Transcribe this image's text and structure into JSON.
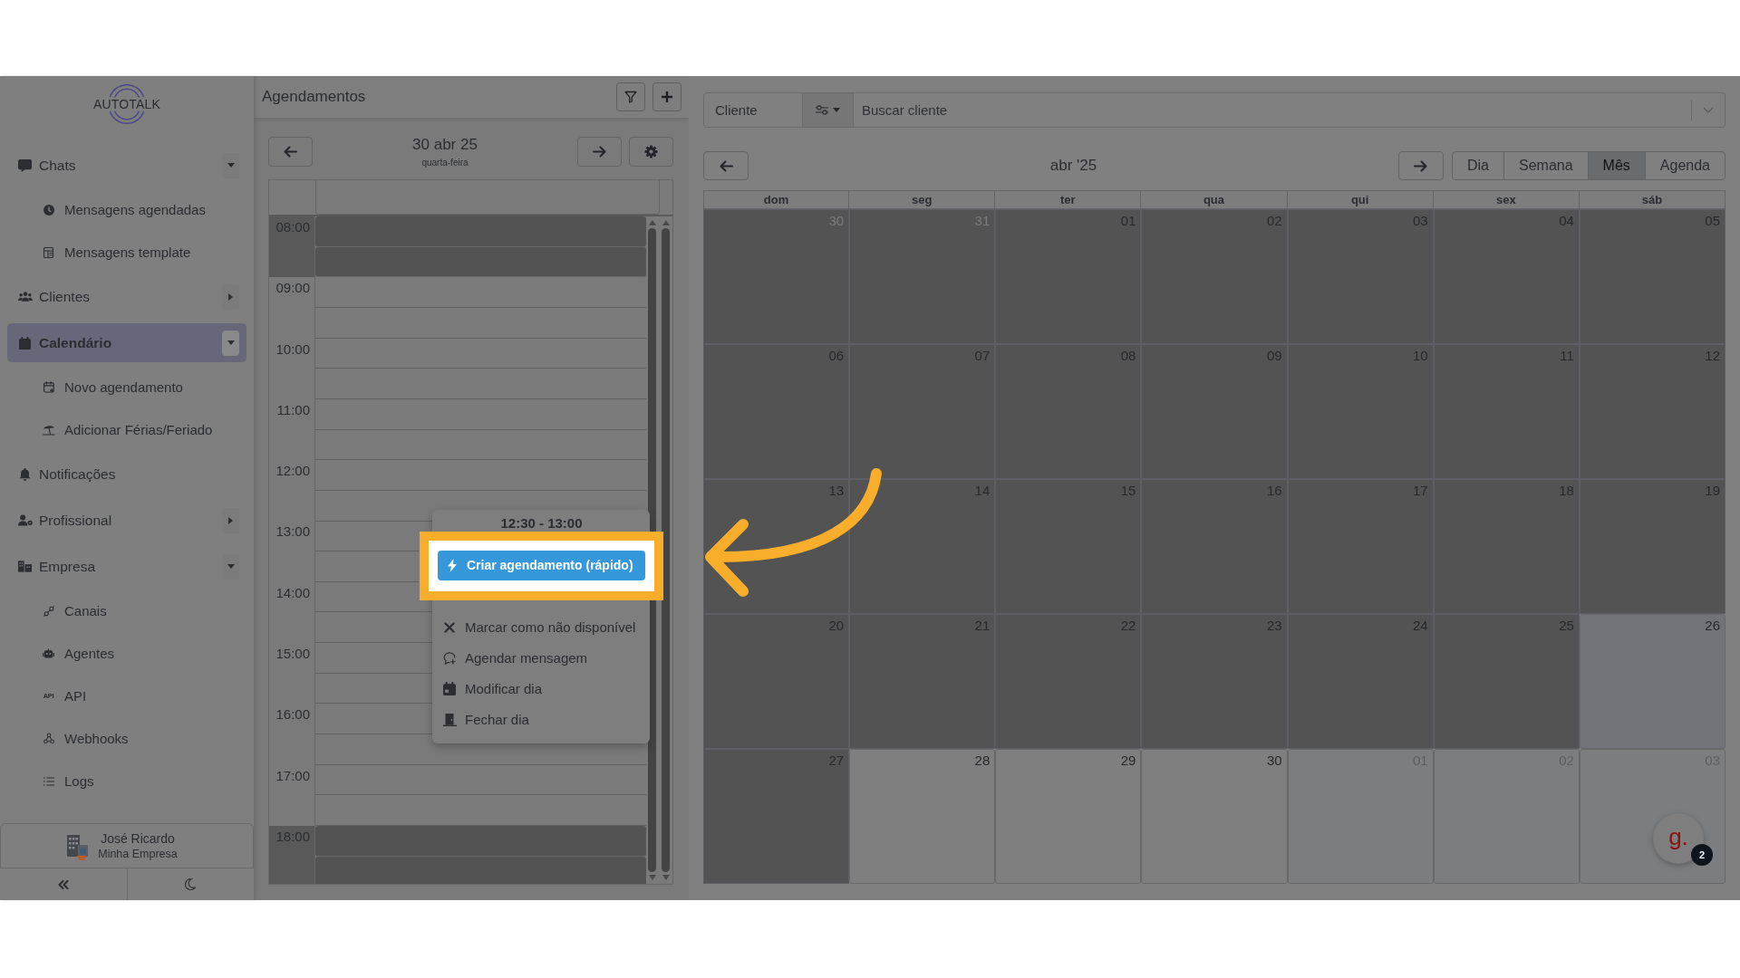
{
  "sidebar": {
    "logo": "AUTOTALK",
    "items": [
      {
        "kind": "group",
        "label": "Chats",
        "expanded": true,
        "selected": false,
        "children": [
          {
            "label": "Mensagens agendadas"
          },
          {
            "label": "Mensagens template"
          }
        ]
      },
      {
        "kind": "group",
        "label": "Clientes",
        "expanded": false,
        "selected": false
      },
      {
        "kind": "group",
        "label": "Calendário",
        "expanded": true,
        "selected": true,
        "children": [
          {
            "label": "Novo agendamento"
          },
          {
            "label": "Adicionar Férias/Feriado"
          }
        ]
      },
      {
        "kind": "link",
        "label": "Notificações",
        "selected": false
      },
      {
        "kind": "group",
        "label": "Profissional",
        "expanded": false,
        "selected": false
      },
      {
        "kind": "group",
        "label": "Empresa",
        "expanded": true,
        "selected": false,
        "children": [
          {
            "label": "Canais"
          },
          {
            "label": "Agentes"
          },
          {
            "label": "API",
            "icon_text": "API"
          },
          {
            "label": "Webhooks"
          },
          {
            "label": "Logs"
          }
        ]
      }
    ],
    "user": {
      "name": "José Ricardo",
      "company": "Minha Empresa"
    }
  },
  "schedule": {
    "title": "Agendamentos",
    "date": "30 abr 25",
    "weekday": "quarta-feira",
    "hours": [
      {
        "label": "08:00",
        "unavailable": true
      },
      {
        "label": "09:00",
        "unavailable": false
      },
      {
        "label": "10:00",
        "unavailable": false
      },
      {
        "label": "11:00",
        "unavailable": false
      },
      {
        "label": "12:00",
        "unavailable": false
      },
      {
        "label": "13:00",
        "unavailable": false
      },
      {
        "label": "14:00",
        "unavailable": false
      },
      {
        "label": "15:00",
        "unavailable": false
      },
      {
        "label": "16:00",
        "unavailable": false
      },
      {
        "label": "17:00",
        "unavailable": false
      },
      {
        "label": "18:00",
        "unavailable": true
      }
    ],
    "context_menu": {
      "title": "12:30 - 13:00",
      "items": [
        {
          "label": "Criar agendamento (rápido)",
          "highlighted": true
        },
        {
          "label": "Marcar como não disponível",
          "highlighted": false
        },
        {
          "label": "Agendar mensagem",
          "highlighted": false
        },
        {
          "label": "Modificar dia",
          "highlighted": false
        },
        {
          "label": "Fechar dia",
          "highlighted": false
        }
      ]
    }
  },
  "calendar": {
    "client_label": "Cliente",
    "search_placeholder": "Buscar cliente",
    "month": "abr '25",
    "views": [
      {
        "label": "Dia",
        "selected": false
      },
      {
        "label": "Semana",
        "selected": false
      },
      {
        "label": "Mês",
        "selected": true
      },
      {
        "label": "Agenda",
        "selected": false
      }
    ],
    "weekdays": [
      "dom",
      "seg",
      "ter",
      "qua",
      "qui",
      "sex",
      "sáb"
    ],
    "weeks": [
      [
        {
          "day": "30",
          "blocked": true,
          "other_month": true,
          "today": false
        },
        {
          "day": "31",
          "blocked": true,
          "other_month": true,
          "today": false
        },
        {
          "day": "01",
          "blocked": true,
          "other_month": false,
          "today": false
        },
        {
          "day": "02",
          "blocked": true,
          "other_month": false,
          "today": false
        },
        {
          "day": "03",
          "blocked": true,
          "other_month": false,
          "today": false
        },
        {
          "day": "04",
          "blocked": true,
          "other_month": false,
          "today": false
        },
        {
          "day": "05",
          "blocked": true,
          "other_month": false,
          "today": false
        }
      ],
      [
        {
          "day": "06",
          "blocked": true,
          "other_month": false,
          "today": false
        },
        {
          "day": "07",
          "blocked": true,
          "other_month": false,
          "today": false
        },
        {
          "day": "08",
          "blocked": true,
          "other_month": false,
          "today": false
        },
        {
          "day": "09",
          "blocked": true,
          "other_month": false,
          "today": false
        },
        {
          "day": "10",
          "blocked": true,
          "other_month": false,
          "today": false
        },
        {
          "day": "11",
          "blocked": true,
          "other_month": false,
          "today": false
        },
        {
          "day": "12",
          "blocked": true,
          "other_month": false,
          "today": false
        }
      ],
      [
        {
          "day": "13",
          "blocked": true,
          "other_month": false,
          "today": false
        },
        {
          "day": "14",
          "blocked": true,
          "other_month": false,
          "today": false
        },
        {
          "day": "15",
          "blocked": true,
          "other_month": false,
          "today": false
        },
        {
          "day": "16",
          "blocked": true,
          "other_month": false,
          "today": false
        },
        {
          "day": "17",
          "blocked": true,
          "other_month": false,
          "today": false
        },
        {
          "day": "18",
          "blocked": true,
          "other_month": false,
          "today": false
        },
        {
          "day": "19",
          "blocked": true,
          "other_month": false,
          "today": false
        }
      ],
      [
        {
          "day": "20",
          "blocked": true,
          "other_month": false,
          "today": false
        },
        {
          "day": "21",
          "blocked": true,
          "other_month": false,
          "today": false
        },
        {
          "day": "22",
          "blocked": true,
          "other_month": false,
          "today": false
        },
        {
          "day": "23",
          "blocked": true,
          "other_month": false,
          "today": false
        },
        {
          "day": "24",
          "blocked": true,
          "other_month": false,
          "today": false
        },
        {
          "day": "25",
          "blocked": true,
          "other_month": false,
          "today": false
        },
        {
          "day": "26",
          "blocked": false,
          "other_month": false,
          "today": true
        }
      ],
      [
        {
          "day": "27",
          "blocked": true,
          "other_month": false,
          "today": false
        },
        {
          "day": "28",
          "blocked": false,
          "other_month": false,
          "today": false
        },
        {
          "day": "29",
          "blocked": false,
          "other_month": false,
          "today": false
        },
        {
          "day": "30",
          "blocked": false,
          "other_month": false,
          "today": false
        },
        {
          "day": "01",
          "blocked": false,
          "other_month": true,
          "today": false
        },
        {
          "day": "02",
          "blocked": false,
          "other_month": true,
          "today": false
        },
        {
          "day": "03",
          "blocked": false,
          "other_month": true,
          "today": false
        }
      ]
    ]
  },
  "chat_widget": {
    "logo": "g.",
    "badge": "2"
  }
}
